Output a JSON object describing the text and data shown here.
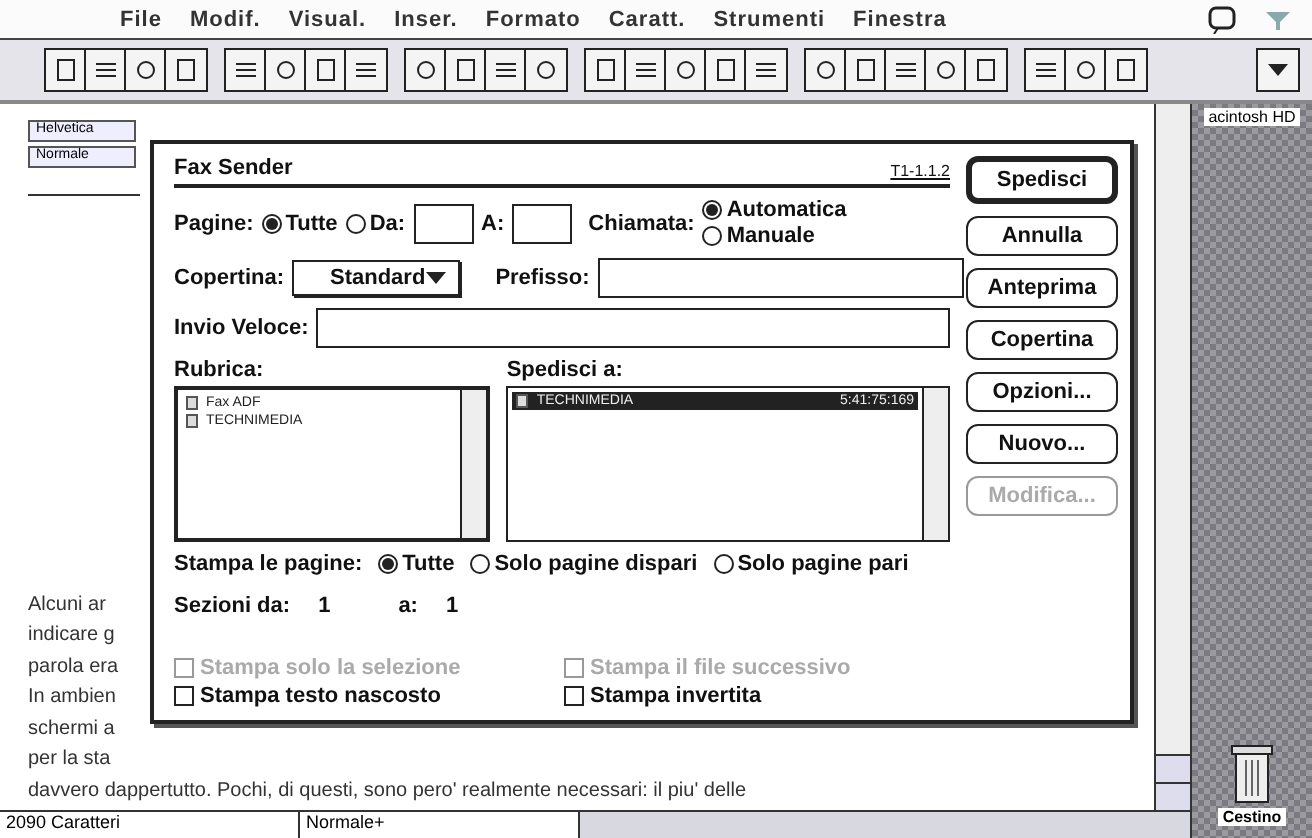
{
  "menu_bar": {
    "items": [
      "File",
      "Modif.",
      "Visual.",
      "Inser.",
      "Formato",
      "Caratt.",
      "Strumenti",
      "Finestra"
    ]
  },
  "document": {
    "font_field": "Helvetica",
    "style_field": "Normale",
    "lines": [
      "Alcuni ar",
      "indicare g",
      "parola era",
      "In ambien",
      "schermi a",
      "per la sta"
    ],
    "full_line": "davvero dappertutto. Pochi, di questi, sono pero' realmente necessari: il piu' delle",
    "status": {
      "count": "2090 Caratteri",
      "style": "Normale+"
    }
  },
  "desktop": {
    "disk_label": "acintosh HD",
    "trash_label": "Cestino"
  },
  "dialog": {
    "title": "Fax Sender",
    "version": "T1-1.1.2",
    "pages": {
      "label": "Pagine:",
      "options": [
        {
          "label": "Tutte",
          "selected": true
        },
        {
          "label": "Da:",
          "selected": false
        }
      ],
      "to_label": "A:"
    },
    "call": {
      "label": "Chiamata:",
      "options": [
        {
          "label": "Automatica",
          "selected": true
        },
        {
          "label": "Manuale",
          "selected": false
        }
      ]
    },
    "cover": {
      "label": "Copertina:",
      "value": "Standard"
    },
    "prefix": {
      "label": "Prefisso:"
    },
    "quick_send": {
      "label": "Invio Veloce:"
    },
    "address_book": {
      "label": "Rubrica:",
      "items": [
        {
          "name": "Fax ADF",
          "selected": false
        },
        {
          "name": "TECHNIMEDIA",
          "selected": false
        }
      ]
    },
    "send_to": {
      "label": "Spedisci a:",
      "items": [
        {
          "name": "TECHNIMEDIA",
          "number": "5:41:75:169",
          "selected": true
        }
      ]
    },
    "print_pages": {
      "label": "Stampa le pagine:",
      "options": [
        {
          "label": "Tutte",
          "selected": true
        },
        {
          "label": "Solo pagine dispari",
          "selected": false
        },
        {
          "label": "Solo pagine pari",
          "selected": false
        }
      ]
    },
    "sections": {
      "label": "Sezioni da:",
      "from": "1",
      "to_label": "a:",
      "to": "1"
    },
    "checkboxes": [
      {
        "label": "Stampa solo la selezione",
        "checked": false,
        "disabled": true
      },
      {
        "label": "Stampa il file successivo",
        "checked": false,
        "disabled": true
      },
      {
        "label": "Stampa testo nascosto",
        "checked": false,
        "disabled": false
      },
      {
        "label": "Stampa invertita",
        "checked": false,
        "disabled": false
      }
    ],
    "buttons": [
      {
        "label": "Spedisci",
        "default": true,
        "disabled": false
      },
      {
        "label": "Annulla",
        "default": false,
        "disabled": false
      },
      {
        "label": "Anteprima",
        "default": false,
        "disabled": false
      },
      {
        "label": "Copertina",
        "default": false,
        "disabled": false
      },
      {
        "label": "Opzioni...",
        "default": false,
        "disabled": false
      },
      {
        "label": "Nuovo...",
        "default": false,
        "disabled": false
      },
      {
        "label": "Modifica...",
        "default": false,
        "disabled": true
      }
    ]
  }
}
